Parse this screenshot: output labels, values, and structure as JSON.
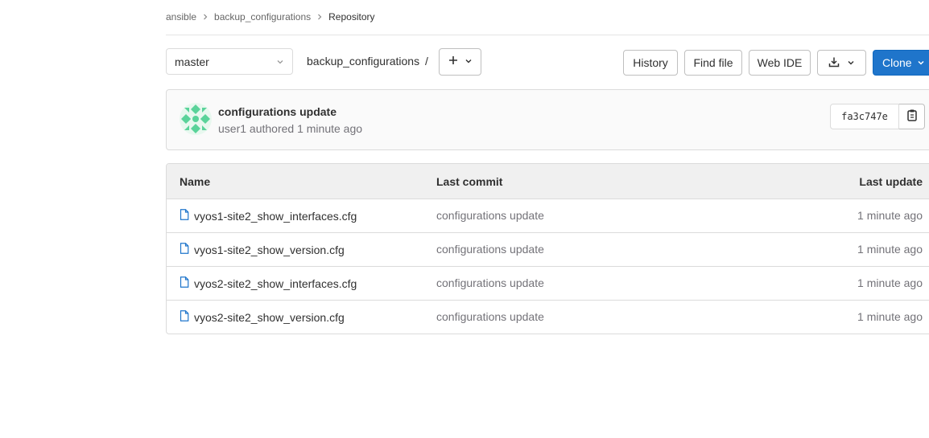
{
  "breadcrumb": {
    "items": [
      {
        "label": "ansible"
      },
      {
        "label": "backup_configurations"
      },
      {
        "label": "Repository"
      }
    ]
  },
  "toolbar": {
    "branch": "master",
    "path": "backup_configurations",
    "path_separator": "/",
    "history_label": "History",
    "find_file_label": "Find file",
    "web_ide_label": "Web IDE",
    "clone_label": "Clone"
  },
  "commit": {
    "title": "configurations update",
    "author": "user1",
    "authored_text": "authored",
    "time": "1 minute ago",
    "sha": "fa3c747e"
  },
  "file_table": {
    "columns": [
      "Name",
      "Last commit",
      "Last update"
    ],
    "rows": [
      {
        "name": "vyos1-site2_show_interfaces.cfg",
        "last_commit": "configurations update",
        "last_update": "1 minute ago"
      },
      {
        "name": "vyos1-site2_show_version.cfg",
        "last_commit": "configurations update",
        "last_update": "1 minute ago"
      },
      {
        "name": "vyos2-site2_show_interfaces.cfg",
        "last_commit": "configurations update",
        "last_update": "1 minute ago"
      },
      {
        "name": "vyos2-site2_show_version.cfg",
        "last_commit": "configurations update",
        "last_update": "1 minute ago"
      }
    ]
  },
  "icons": {
    "breadcrumb_separator": "chevron-right-icon",
    "branch_dropdown": "chevron-down-icon",
    "add": "plus-icon",
    "download": "download-icon",
    "copy": "clipboard-icon",
    "file": "file-icon"
  },
  "colors": {
    "primary": "#1f75cb",
    "file_icon": "#1f75cb",
    "avatar": "#5ad39a"
  }
}
